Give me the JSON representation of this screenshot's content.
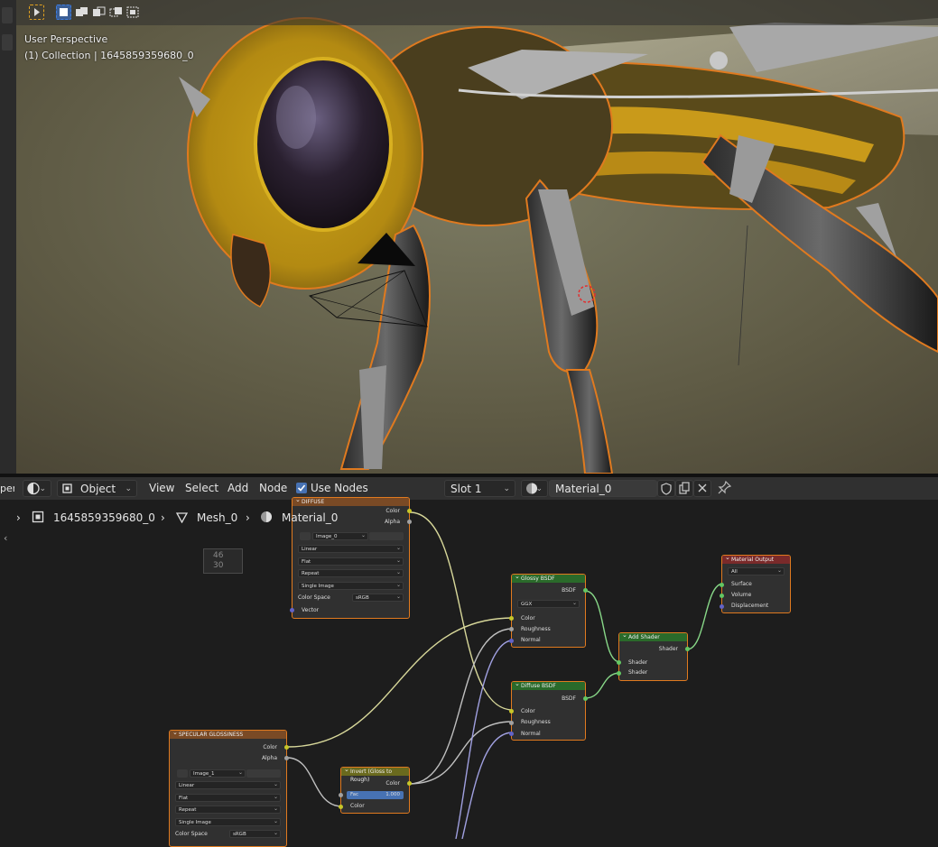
{
  "viewport": {
    "perspective_label": "User Perspective",
    "collection_label": "(1) Collection | 1645859359680_0"
  },
  "header": {
    "editor_type_icon": "node-editor-icon",
    "mode_label": "Object",
    "menus": [
      "View",
      "Select",
      "Add",
      "Node"
    ],
    "use_nodes_label": "Use Nodes",
    "use_nodes_checked": true,
    "slot_label": "Slot 1",
    "material_name": "Material_0",
    "left_cut_label": "per"
  },
  "breadcrumb": {
    "object": "1645859359680_0",
    "mesh": "Mesh_0",
    "material": "Material_0"
  },
  "frame_label": {
    "line1": "46",
    "line2": "30"
  },
  "nodes": {
    "diffuse": {
      "title": "DIFFUSE",
      "out_color": "Color",
      "out_alpha": "Alpha",
      "image": "Image_0",
      "interp": "Linear",
      "proj": "Flat",
      "ext": "Repeat",
      "source": "Single Image",
      "colorspace_label": "Color Space",
      "colorspace": "sRGB",
      "in_vector": "Vector"
    },
    "glossy": {
      "title": "Glossy BSDF",
      "out": "BSDF",
      "dist": "GGX",
      "in_color": "Color",
      "in_rough": "Roughness",
      "in_normal": "Normal"
    },
    "diffuse_bsdf": {
      "title": "Diffuse BSDF",
      "out": "BSDF",
      "in_color": "Color",
      "in_rough": "Roughness",
      "in_normal": "Normal"
    },
    "add_shader": {
      "title": "Add Shader",
      "out": "Shader",
      "in1": "Shader",
      "in2": "Shader"
    },
    "material_output": {
      "title": "Material Output",
      "target": "All",
      "in_surface": "Surface",
      "in_volume": "Volume",
      "in_displacement": "Displacement"
    },
    "specular": {
      "title": "SPECULAR GLOSSINESS",
      "out_color": "Color",
      "out_alpha": "Alpha",
      "image": "Image_1",
      "interp": "Linear",
      "proj": "Flat",
      "ext": "Repeat",
      "source": "Single Image",
      "colorspace_label": "Color Space",
      "colorspace": "sRGB"
    },
    "invert": {
      "title": "Invert (Gloss to Rough)",
      "out_color": "Color",
      "fac_label": "Fac",
      "fac_value": "1.000",
      "in_color": "Color"
    }
  },
  "colors": {
    "selection_outline": "#e07a1f",
    "wire_color": "#d8d89a",
    "wire_shader": "#88d888",
    "wire_vector": "#a0a0e0"
  }
}
